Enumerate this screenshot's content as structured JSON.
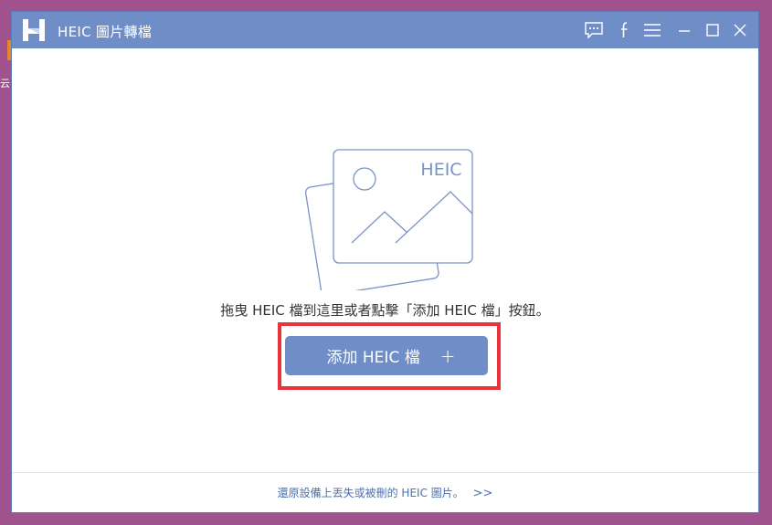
{
  "desktop": {
    "left_glyph": "云"
  },
  "window": {
    "title": "HEIC 圖片轉檔",
    "controls": {
      "feedback_icon": "chat-bubble-icon",
      "facebook_icon": "facebook-icon",
      "menu_icon": "hamburger-menu-icon",
      "minimize_icon": "minimize-icon",
      "maximize_icon": "maximize-icon",
      "close_icon": "close-icon"
    }
  },
  "main": {
    "illustration_label": "HEIC",
    "drop_hint": "拖曳 HEIC 檔到這里或者點擊「添加 HEIC 檔」按鈕。",
    "add_button": {
      "label": "添加 HEIC 檔",
      "plus": "+"
    }
  },
  "footer": {
    "recover_link": "還原設備上丟失或被刪的 HEIC 圖片。",
    "arrows": ">>"
  },
  "colors": {
    "titlebar": "#6f8dc7",
    "accent": "#6f8dc7",
    "highlight": "#e8343a",
    "desktop": "#a0528f",
    "link": "#4d6faa"
  }
}
